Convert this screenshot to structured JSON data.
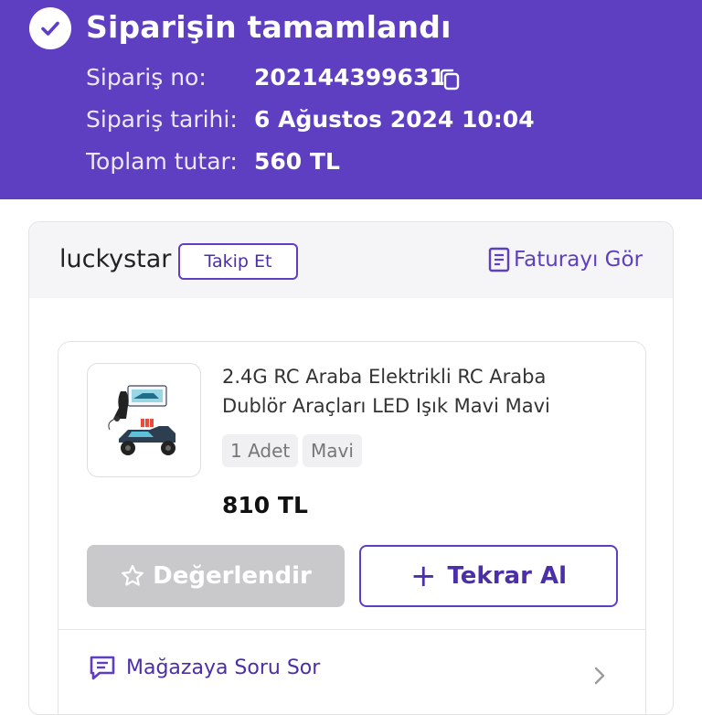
{
  "header": {
    "title": "Siparişin tamamlandı",
    "order_no_label": "Sipariş no:",
    "order_no": "202144399631",
    "order_date_label": "Sipariş tarihi:",
    "order_date": "6 Ağustos 2024 10:04",
    "total_label": "Toplam tutar:",
    "total": "560 TL",
    "bg_color": "#5e3ec1"
  },
  "store": {
    "name": "luckystar",
    "follow_label": "Takip Et",
    "invoice_label": "Faturayı Gör"
  },
  "product": {
    "name": "2.4G RC Araba Elektrikli RC Araba Dublör Araçları LED Işık Mavi Mavi",
    "quantity": "1 Adet",
    "variant": "Mavi",
    "price": "810 TL",
    "rate_label": "Değerlendir",
    "rebuy_label": "Tekrar Al",
    "ask_label": "Mağazaya Soru Sor"
  },
  "icons": [
    "check-icon",
    "copy-icon",
    "invoice-icon",
    "star-icon",
    "plus-icon",
    "chat-icon",
    "chevron-right-icon"
  ]
}
